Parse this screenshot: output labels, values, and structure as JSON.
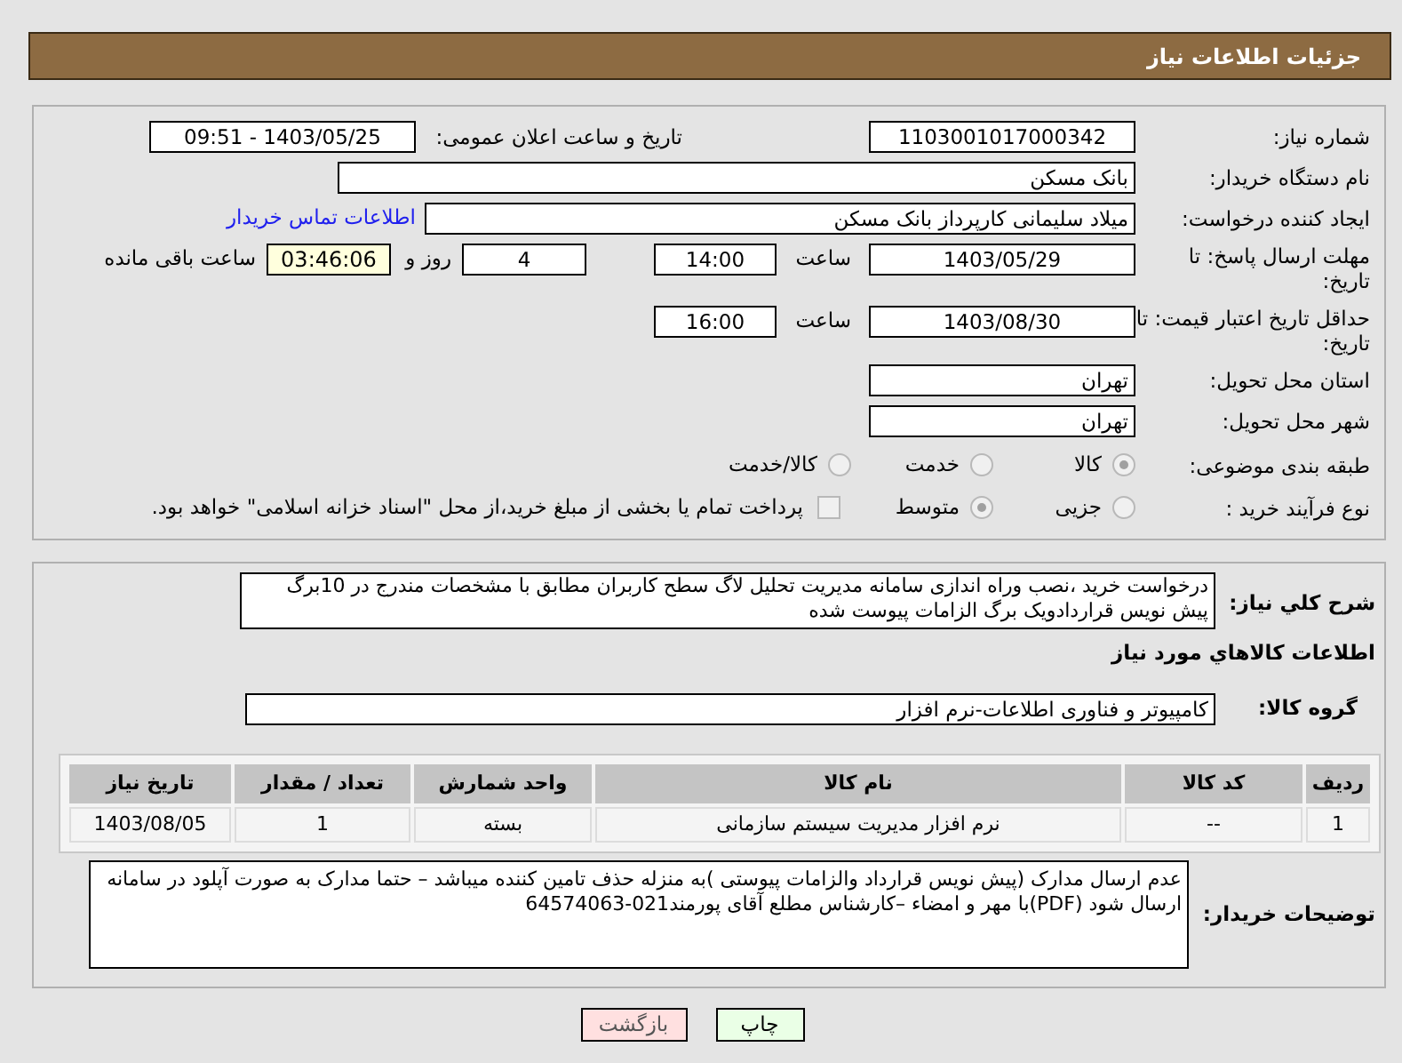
{
  "header": {
    "title": "جزئیات اطلاعات نیاز"
  },
  "details": {
    "need_number": {
      "label": "شماره نیاز:",
      "value": "1103001017000342"
    },
    "announce": {
      "label": "تاریخ و ساعت اعلان عمومی:",
      "value": "1403/05/25 - 09:51"
    },
    "buyer_org": {
      "label": "نام دستگاه خریدار:",
      "value": "بانک مسکن"
    },
    "requester": {
      "label": "ایجاد کننده درخواست:",
      "value": "میلاد سلیمانی کارپرداز بانک مسکن",
      "link": "اطلاعات تماس خریدار"
    },
    "response_deadline": {
      "label": "مهلت ارسال پاسخ: تا تاریخ:",
      "date": "1403/05/29",
      "time_label": "ساعت",
      "time": "14:00",
      "days": "4",
      "days_label": "روز و",
      "remaining": "03:46:06",
      "remaining_label": "ساعت باقی مانده"
    },
    "price_validity": {
      "label": "حداقل تاریخ اعتبار قیمت: تا تاریخ:",
      "date": "1403/08/30",
      "time_label": "ساعت",
      "time": "16:00"
    },
    "province": {
      "label": "استان محل تحویل:",
      "value": "تهران"
    },
    "city": {
      "label": "شهر محل تحویل:",
      "value": "تهران"
    },
    "category": {
      "label": "طبقه بندی موضوعی:",
      "options": [
        {
          "label": "کالا",
          "selected": true
        },
        {
          "label": "خدمت",
          "selected": false
        },
        {
          "label": "کالا/خدمت",
          "selected": false
        }
      ]
    },
    "process": {
      "label": "نوع فرآیند خرید :",
      "options": [
        {
          "label": "جزیی",
          "selected": false
        },
        {
          "label": "متوسط",
          "selected": true
        }
      ],
      "treasury": {
        "label": "پرداخت تمام یا بخشی از مبلغ خرید،از محل \"اسناد خزانه اسلامی\" خواهد بود.",
        "checked": false
      }
    }
  },
  "goods": {
    "description_label": "شرح کلي نياز:",
    "description": "درخواست خرید ،نصب وراه اندازی سامانه مدیریت تحلیل لاگ سطح کاربران مطابق با مشخصات مندرج در 10برگ پیش نویس قراردادویک برگ الزامات پیوست شده",
    "section_title": "اطلاعات کالاهاي مورد نياز",
    "group_label": "گروه کالا:",
    "group": "کامپیوتر و فناوری اطلاعات-نرم افزار",
    "table": {
      "columns": [
        "ردیف",
        "کد کالا",
        "نام کالا",
        "واحد شمارش",
        "تعداد / مقدار",
        "تاریخ نیاز"
      ],
      "rows": [
        [
          "1",
          "--",
          "نرم افزار مدیریت سیستم سازمانی",
          "بسته",
          "1",
          "1403/08/05"
        ]
      ]
    },
    "notes_label": "توضیحات خریدار:",
    "notes": "عدم ارسال مدارک (پیش نویس قرارداد والزامات پیوستی )به منزله حذف تامین کننده میباشد – حتما مدارک به صورت آپلود در سامانه ارسال شود (PDF)با مهر و امضاء –کارشناس مطلع آقای پورمند021-64574063"
  },
  "buttons": [
    {
      "label": "چاپ",
      "kind": "print"
    },
    {
      "label": "بازگشت",
      "kind": "back"
    }
  ]
}
